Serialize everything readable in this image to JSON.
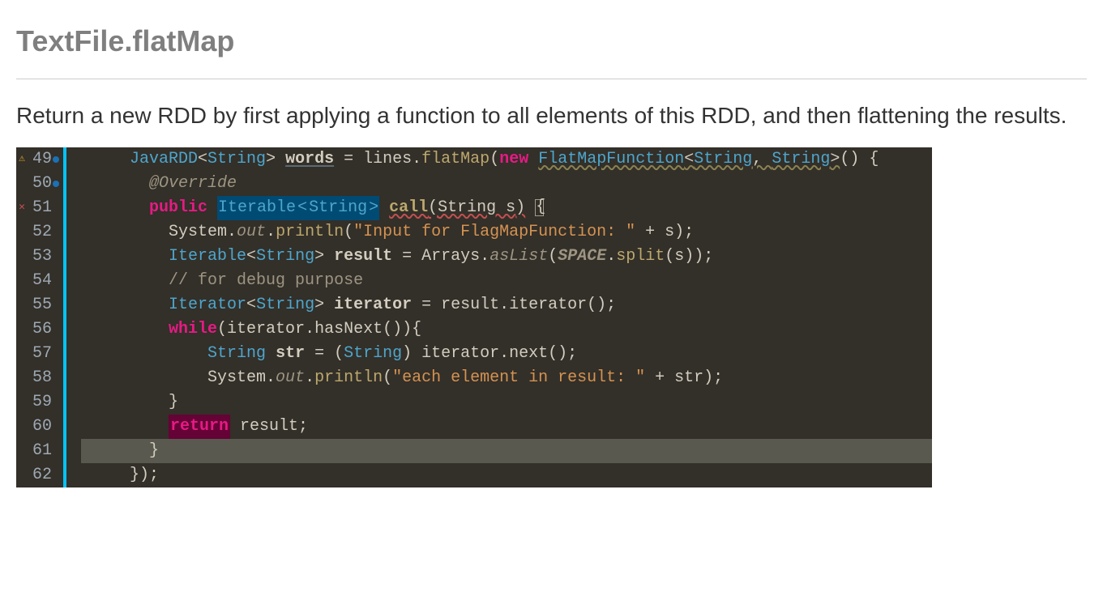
{
  "title": "TextFile.flatMap",
  "description": "Return a new RDD by first applying a function to all elements of this RDD, and then flattening the results.",
  "code": {
    "line_numbers": [
      "49",
      "50",
      "51",
      "52",
      "53",
      "54",
      "55",
      "56",
      "57",
      "58",
      "59",
      "60",
      "61",
      "62"
    ],
    "lines": {
      "l49": {
        "indent": "     ",
        "JavaRDD": "JavaRDD",
        "lt1": "<",
        "String1": "String",
        "gt1": ">",
        "sp1": " ",
        "words": "words",
        "sp2": " ",
        "eq": "=",
        "sp3": " ",
        "linesdot": "lines.",
        "flatMap": "flatMap",
        "paren1": "(",
        "new": "new",
        "sp4": " ",
        "FlatMapFunction": "FlatMapFunction",
        "lt2": "<",
        "String2": "String",
        "comma": ", ",
        "String3": "String",
        "gt2": ">",
        "tail": "() {"
      },
      "l50": {
        "indent": "       ",
        "Override": "@Override"
      },
      "l51": {
        "indent": "       ",
        "public": "public",
        "sp1": " ",
        "Iterable": "Iterable",
        "lt": "<",
        "String": "String",
        "gt": ">",
        "sp2": " ",
        "call": "call",
        "paren1": "(",
        "param": "String s",
        "paren2": ")",
        "sp3": " ",
        "brace": "{"
      },
      "l52": {
        "indent": "         ",
        "System": "System.",
        "out": "out",
        "dot": ".",
        "println": "println",
        "paren1": "(",
        "str": "\"Input for FlagMapFunction: \"",
        "rest": " + s);"
      },
      "l53": {
        "indent": "         ",
        "Iterable": "Iterable",
        "lt": "<",
        "String": "String",
        "gt": ">",
        "sp": " ",
        "result": "result",
        "sp2": " ",
        "eq": "=",
        "sp3": " ",
        "Arrays": "Arrays.",
        "asList": "asList",
        "paren1": "(",
        "SPACE": "SPACE",
        "dot": ".",
        "split": "split",
        "tail": "(s));"
      },
      "l54": {
        "indent": "         ",
        "comment": "// for debug purpose"
      },
      "l55": {
        "indent": "         ",
        "Iterator": "Iterator",
        "lt": "<",
        "String": "String",
        "gt": ">",
        "sp": " ",
        "iterator": "iterator",
        "rest": " = result.iterator();"
      },
      "l56": {
        "indent": "         ",
        "while": "while",
        "rest": "(iterator.hasNext()){"
      },
      "l57": {
        "indent": "             ",
        "String": "String",
        "sp": " ",
        "str": "str",
        "rest": " = (",
        "String2": "String",
        "rest2": ") iterator.next();"
      },
      "l58": {
        "indent": "             ",
        "System": "System.",
        "out": "out",
        "dot": ".",
        "println": "println",
        "paren1": "(",
        "str": "\"each element in result: \"",
        "rest": " + str);"
      },
      "l59": {
        "indent": "         ",
        "brace": "}"
      },
      "l60": {
        "indent": "         ",
        "return": "return",
        "rest": " result;"
      },
      "l61": {
        "indent": "       ",
        "brace": "}"
      },
      "l62": {
        "indent": "     ",
        "rest": "});"
      }
    }
  }
}
